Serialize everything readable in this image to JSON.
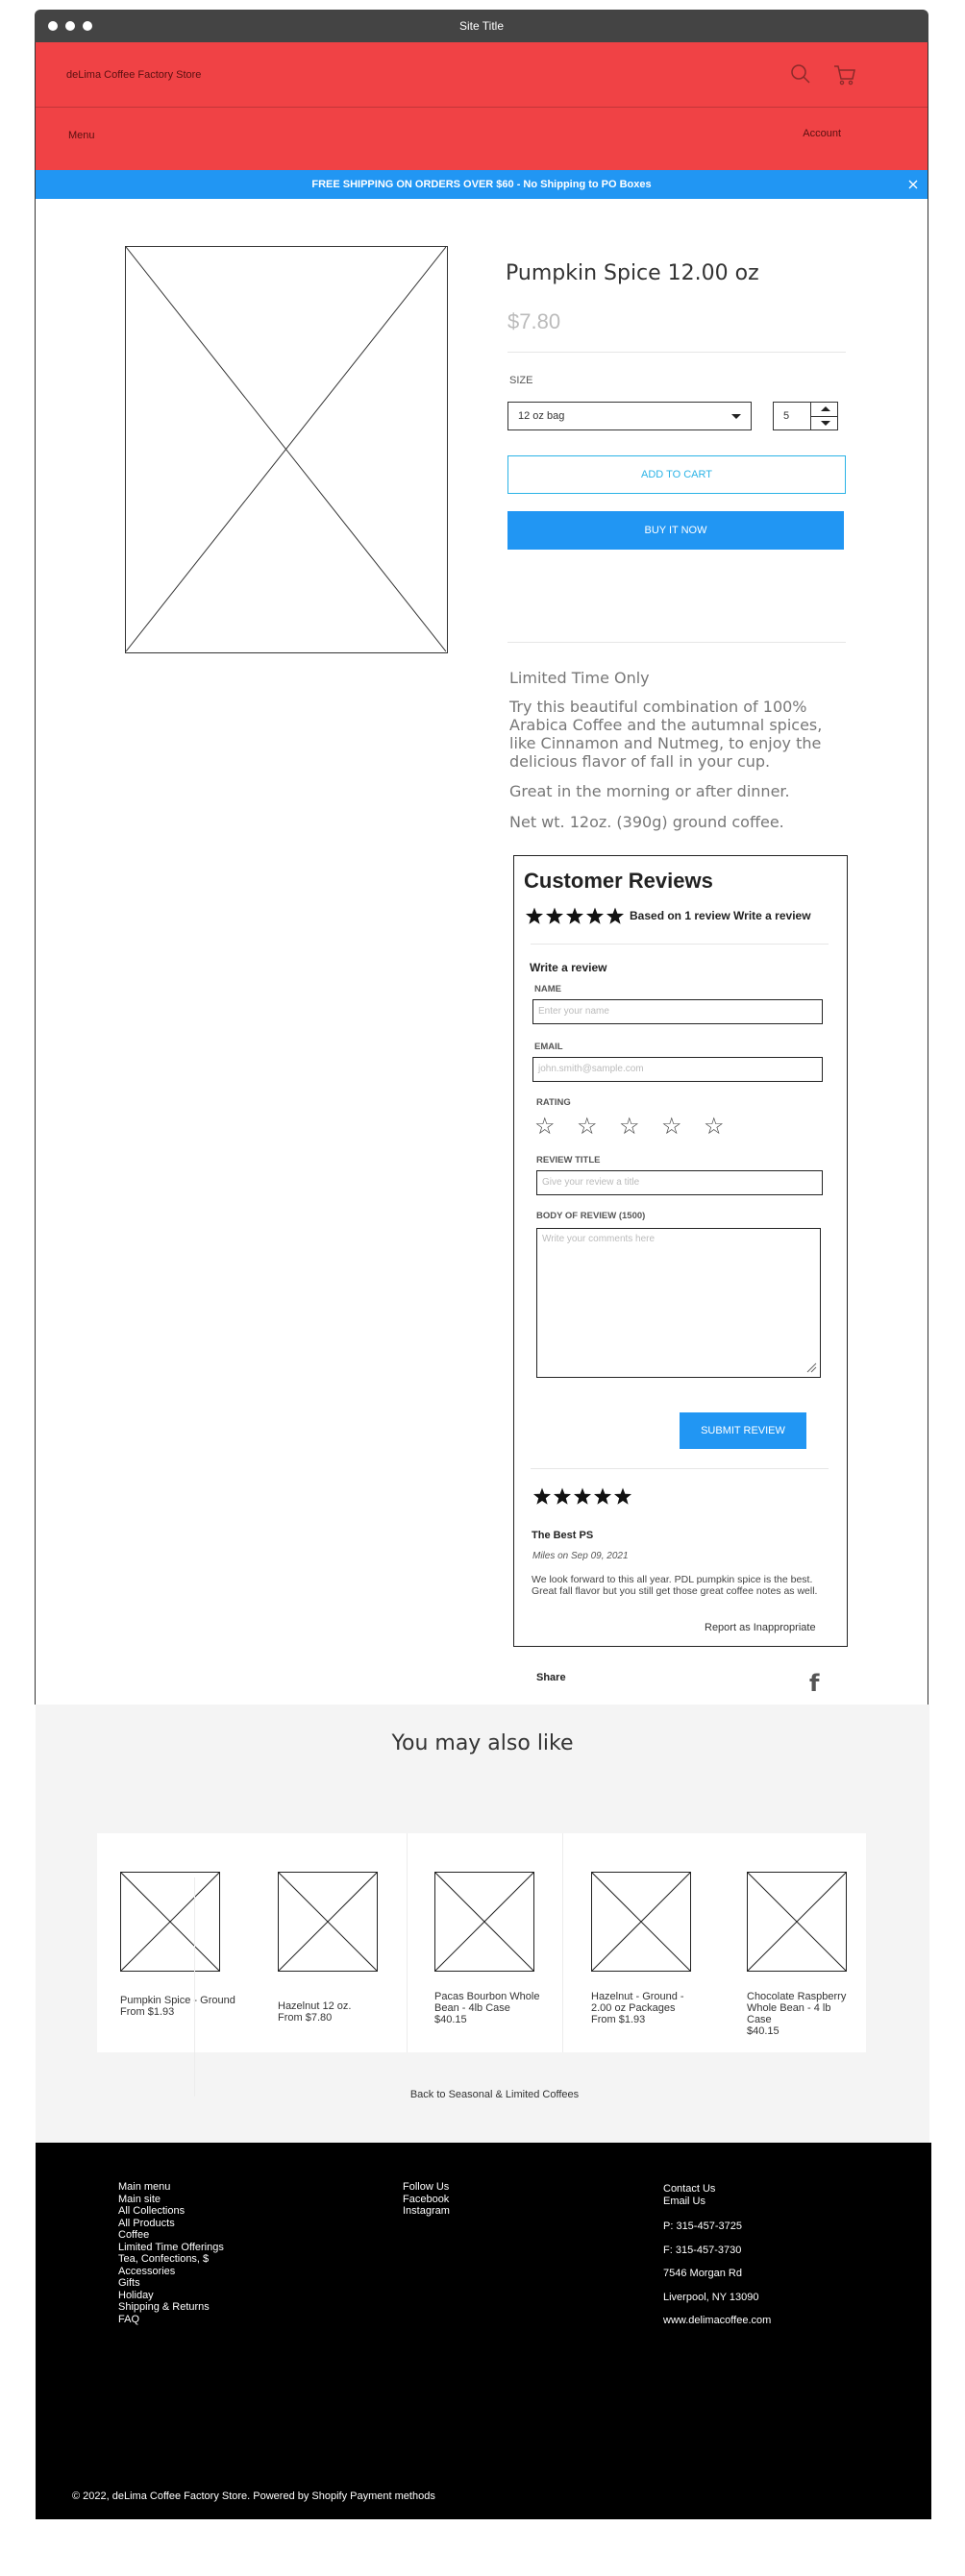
{
  "window": {
    "title": "Site Title"
  },
  "header": {
    "store_name": "deLima Coffee Factory Store",
    "menu_label": "Menu",
    "account_label": "Account",
    "icons": [
      "search-icon",
      "cart-icon"
    ]
  },
  "banner": {
    "text": "FREE SHIPPING ON ORDERS OVER $60 - No Shipping to PO Boxes",
    "close_icon": "close-icon"
  },
  "product": {
    "title": "Pumpkin Spice 12.00 oz",
    "price": "$7.80",
    "size_label": "SIZE",
    "size_value": "12 oz bag",
    "quantity": "5",
    "add_to_cart": "ADD TO CART",
    "buy_now": "BUY IT NOW",
    "desc_heading": "Limited Time Only",
    "desc_body": "Try this beautiful combination of 100% Arabica Coffee and the autumnal spices, like Cinnamon and Nutmeg, to enjoy the delicious flavor of fall in your cup.",
    "desc_line2": "Great in the morning or after dinner.",
    "desc_line3": "Net wt. 12oz. (390g) ground coffee."
  },
  "reviews": {
    "title": "Customer Reviews",
    "summary": "Based on 1 review Write a review",
    "stars": 5,
    "form": {
      "heading": "Write a review",
      "name_label": "NAME",
      "name_placeholder": "Enter your name",
      "email_label": "EMAIL",
      "email_placeholder": "john.smith@sample.com",
      "rating_label": "RATING",
      "review_title_label": "REVIEW TITLE",
      "review_title_placeholder": "Give your review a title",
      "body_label": "BODY OF REVIEW (1500)",
      "body_placeholder": "Write your comments here",
      "submit": "SUBMIT REVIEW"
    },
    "items": [
      {
        "stars": 5,
        "title": "The Best PS",
        "meta": "Miles on Sep 09, 2021",
        "body": "We look forward to this all year. PDL pumpkin spice is the best. Great fall flavor but you still get those great coffee notes as well.",
        "report": "Report as Inappropriate"
      }
    ],
    "share_label": "Share"
  },
  "also_like": {
    "title": "You may also like",
    "products": [
      {
        "name": "Pumpkin Spice - Ground",
        "price": "From $1.93"
      },
      {
        "name": "Hazelnut 12 oz.",
        "price": "From $7.80"
      },
      {
        "name": "Pacas Bourbon Whole Bean - 4lb Case",
        "price": "$40.15"
      },
      {
        "name": "Hazelnut - Ground - 2.00 oz Packages",
        "price": "From $1.93"
      },
      {
        "name": "Chocolate Raspberry Whole Bean - 4 lb Case",
        "price": "$40.15"
      }
    ],
    "back_link": "Back to Seasonal & Limited Coffees"
  },
  "footer": {
    "main_menu": [
      "Main menu",
      "Main site",
      "All Collections",
      "All Products",
      "Coffee",
      "Limited Time Offerings",
      "Tea, Confections, $",
      "Accessories",
      "Gifts",
      "Holiday",
      "Shipping & Returns",
      "FAQ"
    ],
    "follow": [
      "Follow Us",
      "Facebook",
      "Instagram"
    ],
    "contact": [
      "Contact Us",
      "Email Us"
    ],
    "phone": "P: 315-457-3725",
    "fax": "F: 315-457-3730",
    "address1": "7546 Morgan Rd",
    "address2": "Liverpool, NY 13090",
    "website": "www.delimacoffee.com",
    "copyright": "© 2022, deLima Coffee Factory Store. Powered by Shopify Payment methods"
  },
  "colors": {
    "header": "#f04245",
    "accent": "#2196f3",
    "footer": "#000000",
    "section_bg": "#f4f4f4"
  }
}
